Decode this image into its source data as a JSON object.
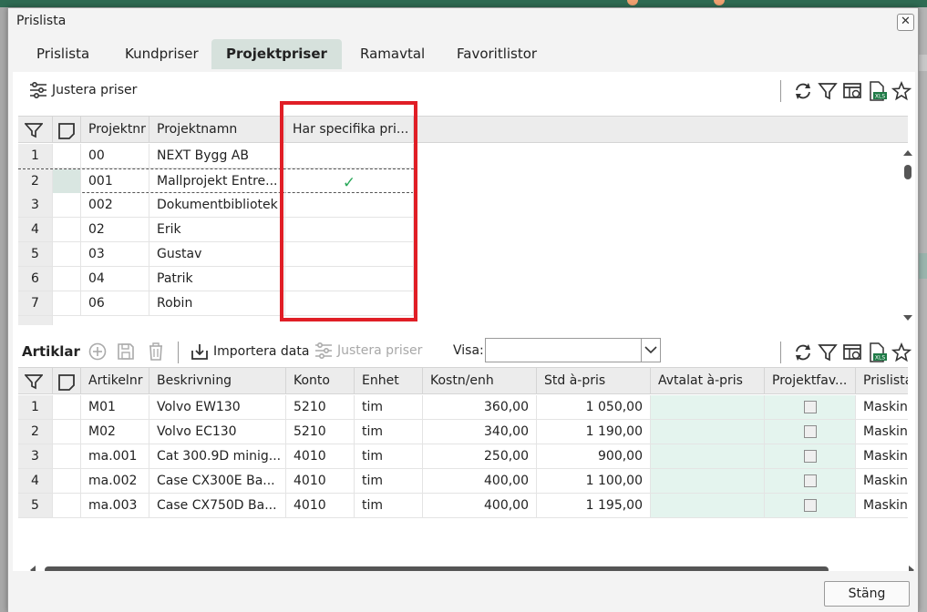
{
  "window": {
    "title": "Prislista",
    "close_glyph": "✕"
  },
  "tabs": [
    {
      "label": "Prislista",
      "active": false
    },
    {
      "label": "Kundpriser",
      "active": false
    },
    {
      "label": "Projektpriser",
      "active": true
    },
    {
      "label": "Ramavtal",
      "active": false
    },
    {
      "label": "Favoritlistor",
      "active": false
    }
  ],
  "top_toolbar": {
    "adjust_prices_label": "Justera priser",
    "icons": [
      "refresh-icon",
      "filter-icon",
      "columns-icon",
      "excel-export-icon",
      "favorite-star-icon"
    ]
  },
  "projects_grid": {
    "columns": [
      "Projektnr",
      "Projektnamn",
      "Har specifika pri..."
    ],
    "rows": [
      {
        "n": "1",
        "nr": "00",
        "name": "NEXT Bygg AB",
        "specific": false
      },
      {
        "n": "2",
        "nr": "001",
        "name": "Mallprojekt Entre...",
        "specific": true
      },
      {
        "n": "3",
        "nr": "002",
        "name": "Dokumentbibliotek",
        "specific": false
      },
      {
        "n": "4",
        "nr": "02",
        "name": "Erik",
        "specific": false
      },
      {
        "n": "5",
        "nr": "03",
        "name": "Gustav",
        "specific": false
      },
      {
        "n": "6",
        "nr": "04",
        "name": "Patrik",
        "specific": false
      },
      {
        "n": "7",
        "nr": "06",
        "name": "Robin",
        "specific": false
      }
    ],
    "check_glyph": "✓"
  },
  "articles_toolbar": {
    "section_label": "Artiklar",
    "import_label": "Importera data",
    "adjust_prices_label": "Justera priser",
    "visa_label": "Visa:",
    "visa_value": ""
  },
  "articles_grid": {
    "columns": [
      "Artikelnr",
      "Beskrivning",
      "Konto",
      "Enhet",
      "Kostn/enh",
      "Std à-pris",
      "Avtalat à-pris",
      "Projektfav...",
      "Prislista"
    ],
    "rows": [
      {
        "n": "1",
        "nr": "M01",
        "desc": "Volvo EW130",
        "konto": "5210",
        "enhet": "tim",
        "kostn": "360,00",
        "std": "1 050,00",
        "avtalat": "",
        "fav": false,
        "prislista": "Maskiner"
      },
      {
        "n": "2",
        "nr": "M02",
        "desc": "Volvo EC130",
        "konto": "5210",
        "enhet": "tim",
        "kostn": "340,00",
        "std": "1 190,00",
        "avtalat": "",
        "fav": false,
        "prislista": "Maskiner"
      },
      {
        "n": "3",
        "nr": "ma.001",
        "desc": "Cat 300.9D minig...",
        "konto": "4010",
        "enhet": "tim",
        "kostn": "250,00",
        "std": "900,00",
        "avtalat": "",
        "fav": false,
        "prislista": "Maskiner"
      },
      {
        "n": "4",
        "nr": "ma.002",
        "desc": "Case CX300E Ba...",
        "konto": "4010",
        "enhet": "tim",
        "kostn": "400,00",
        "std": "1 100,00",
        "avtalat": "",
        "fav": false,
        "prislista": "Maskiner"
      },
      {
        "n": "5",
        "nr": "ma.003",
        "desc": "Case CX750D Ba...",
        "konto": "4010",
        "enhet": "tim",
        "kostn": "400,00",
        "std": "1 195,00",
        "avtalat": "",
        "fav": false,
        "prislista": "Maskiner"
      }
    ]
  },
  "footer": {
    "close_label": "Stäng"
  },
  "colors": {
    "active_tab": "#d6e1dc",
    "accent_green": "#2f6b53",
    "check_green": "#2aa85a",
    "highlight_red": "#e01e26",
    "editable_cell": "#e4f4ee"
  }
}
